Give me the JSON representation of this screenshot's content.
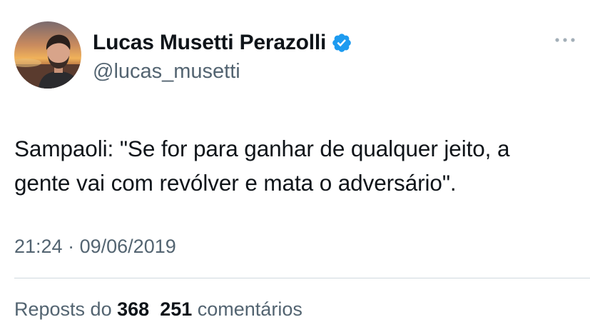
{
  "author": {
    "display_name": "Lucas Musetti Perazolli",
    "handle": "@lucas_musetti",
    "verified": true,
    "avatar": "profile-photo"
  },
  "tweet": {
    "text_line1": "Sampaoli: \"Se for para ganhar de qualquer jeito, a",
    "text_line2": "gente vai com revólver e mata o adversário\".",
    "time": "21:24",
    "separator": "·",
    "date": "09/06/2019"
  },
  "stats": {
    "reposts_prefix": "Reposts do",
    "reposts_count": "368",
    "comments_count": "251",
    "comments_label": "comentários"
  },
  "colors": {
    "text": "#0f1419",
    "secondary": "#536471",
    "verified_blue": "#1d9bf0",
    "divider": "#cfd9de"
  },
  "icons": {
    "more": "more-horizontal-icon",
    "verified": "verified-badge-icon"
  }
}
